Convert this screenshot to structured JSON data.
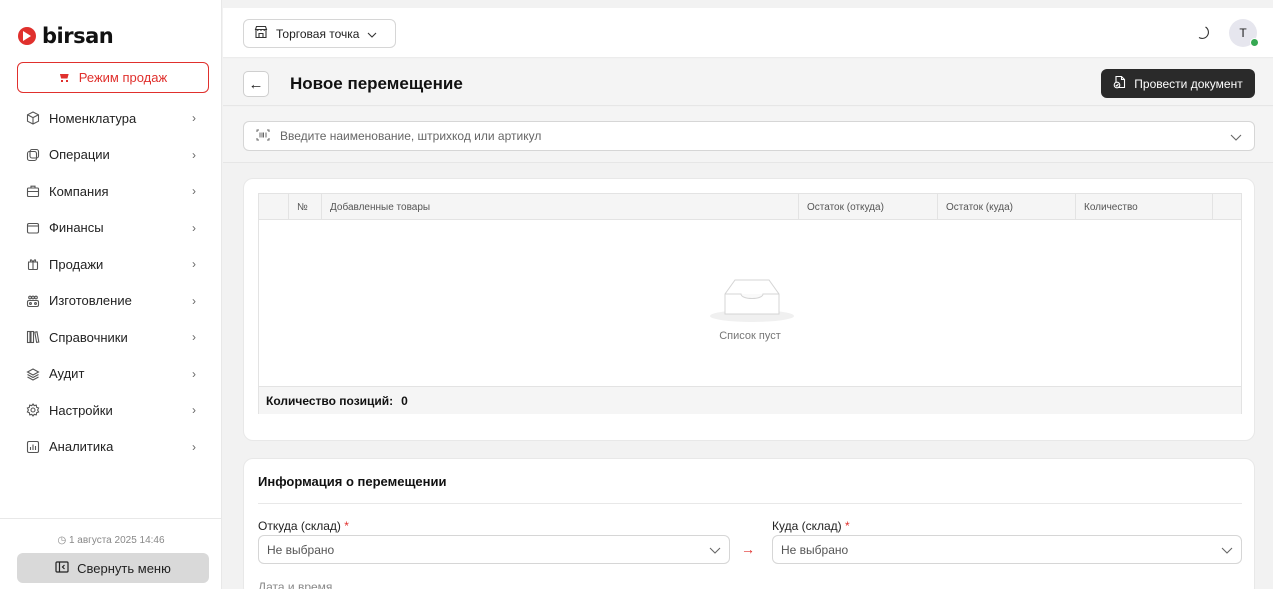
{
  "app": {
    "logo_text": "birsan"
  },
  "sidebar": {
    "sale_mode_label": "Режим продаж",
    "items": [
      {
        "label": "Номенклатура",
        "icon": "box-icon"
      },
      {
        "label": "Операции",
        "icon": "operations-icon"
      },
      {
        "label": "Компания",
        "icon": "briefcase-icon"
      },
      {
        "label": "Финансы",
        "icon": "wallet-icon"
      },
      {
        "label": "Продажи",
        "icon": "gift-icon"
      },
      {
        "label": "Изготовление",
        "icon": "factory-icon"
      },
      {
        "label": "Справочники",
        "icon": "books-icon"
      },
      {
        "label": "Аудит",
        "icon": "layers-icon"
      },
      {
        "label": "Настройки",
        "icon": "gear-icon"
      },
      {
        "label": "Аналитика",
        "icon": "chart-icon"
      }
    ],
    "date": "1 августа 2025 14:46",
    "collapse_label": "Свернуть меню"
  },
  "topbar": {
    "store_label": "Торговая точка",
    "avatar_initial": "T"
  },
  "page": {
    "title": "Новое перемещение",
    "post_button_label": "Провести документ"
  },
  "search": {
    "placeholder": "Введите наименование, штрихкод или артикул"
  },
  "table": {
    "columns": [
      "№",
      "Добавленные товары",
      "Остаток (откуда)",
      "Остаток (куда)",
      "Количество"
    ],
    "empty_text": "Список пуст",
    "footer_label": "Количество позиций:",
    "footer_count": "0"
  },
  "info": {
    "title": "Информация о перемещении",
    "from_label": "Откуда (склад)",
    "from_value": "Не выбрано",
    "to_label": "Куда (склад)",
    "to_value": "Не выбрано",
    "required_mark": "*",
    "date_label": "Дата и время"
  }
}
